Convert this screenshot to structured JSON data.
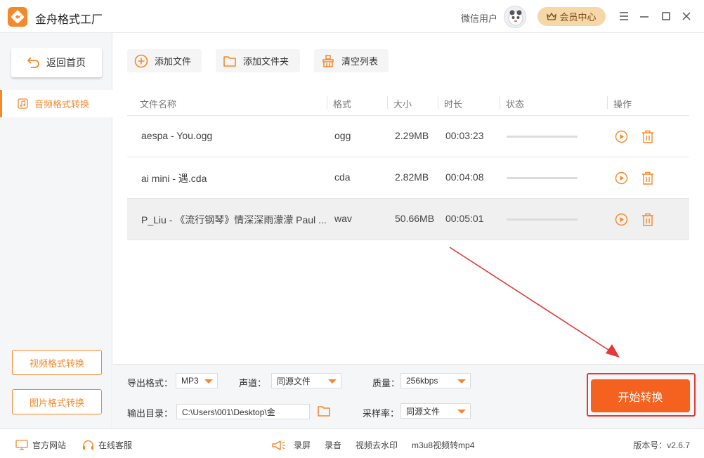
{
  "app": {
    "title": "金舟格式工厂",
    "username": "微信用户",
    "vip_label": "会员中心"
  },
  "sidebar": {
    "home_label": "返回首页",
    "active_item": "音频格式转换",
    "bottom_buttons": [
      "视频格式转换",
      "图片格式转换"
    ]
  },
  "toolbar": {
    "add_file": "添加文件",
    "add_folder": "添加文件夹",
    "clear_list": "清空列表"
  },
  "table": {
    "headers": {
      "name": "文件名称",
      "format": "格式",
      "size": "大小",
      "duration": "时长",
      "status": "状态",
      "action": "操作"
    },
    "rows": [
      {
        "name": "aespa - You.ogg",
        "format": "ogg",
        "size": "2.29MB",
        "duration": "00:03:23"
      },
      {
        "name": "ai mini - 遇.cda",
        "format": "cda",
        "size": "2.82MB",
        "duration": "00:04:08"
      },
      {
        "name": "P_Liu - 《流行钢琴》情深深雨濛濛 Paul ...",
        "format": "wav",
        "size": "50.66MB",
        "duration": "00:05:01"
      }
    ]
  },
  "settings": {
    "output_format_label": "导出格式：",
    "output_format_value": "MP3",
    "channel_label": "声道：",
    "channel_value": "同源文件",
    "quality_label": "质量：",
    "quality_value": "256kbps",
    "output_dir_label": "输出目录：",
    "output_dir_value": "C:\\Users\\001\\Desktop\\金",
    "sample_rate_label": "采样率：",
    "sample_rate_value": "同源文件"
  },
  "start_button": "开始转换",
  "statusbar": {
    "website": "官方网站",
    "support": "在线客服",
    "screen_record": "录屏",
    "audio_record": "录音",
    "remove_watermark": "视频去水印",
    "m3u8": "m3u8视频转mp4",
    "version": "版本号：v2.6.7"
  },
  "colors": {
    "accent": "#f6882a",
    "start_button": "#f5611f",
    "highlight": "#e53935"
  }
}
